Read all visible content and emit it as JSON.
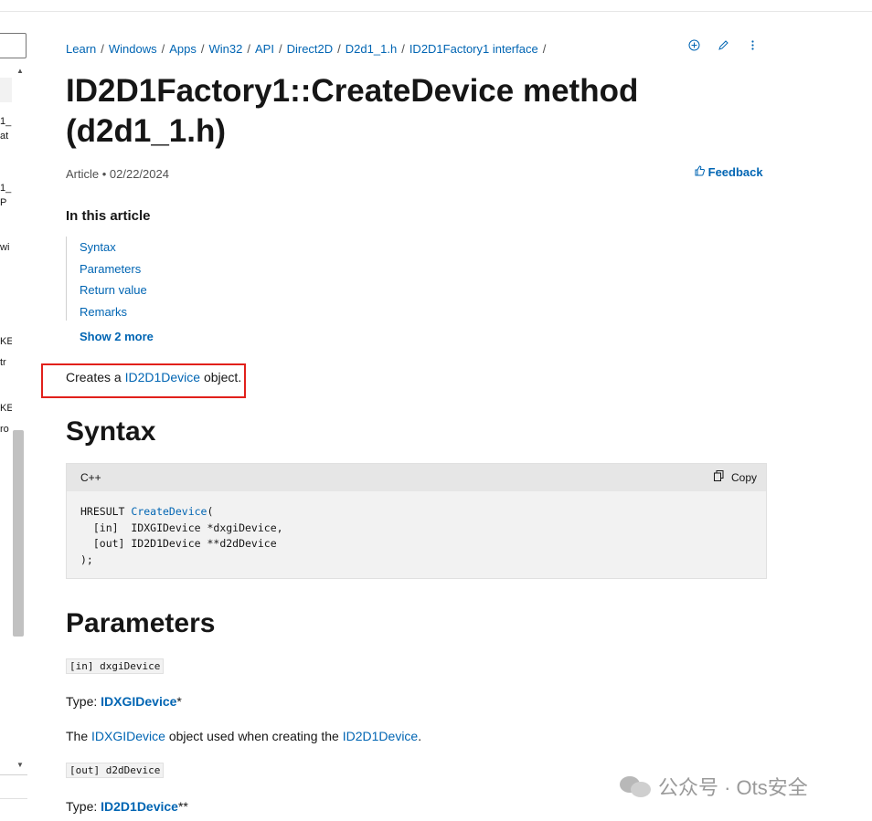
{
  "breadcrumb": [
    "Learn",
    "Windows",
    "Apps",
    "Win32",
    "API",
    "Direct2D",
    "D2d1_1.h",
    "ID2D1Factory1 interface"
  ],
  "separator": "/",
  "title": "ID2D1Factory1::CreateDevice method (d2d1_1.h)",
  "meta": "Article • 02/22/2024",
  "feedback": "Feedback",
  "in_this_article": {
    "heading": "In this article",
    "items": [
      "Syntax",
      "Parameters",
      "Return value",
      "Remarks"
    ],
    "show_more": "Show 2 more"
  },
  "description": {
    "pre": "Creates a ",
    "link": "ID2D1Device",
    "post": " object."
  },
  "syntax": {
    "heading": "Syntax",
    "lang": "C++",
    "copy": "Copy",
    "lines": [
      {
        "pre": "HRESULT ",
        "fn": "CreateDevice",
        "post": "("
      },
      {
        "pre": "  [in]  IDXGIDevice *dxgiDevice,",
        "fn": "",
        "post": ""
      },
      {
        "pre": "  [out] ID2D1Device **d2dDevice",
        "fn": "",
        "post": ""
      },
      {
        "pre": ");",
        "fn": "",
        "post": ""
      }
    ]
  },
  "parameters": {
    "heading": "Parameters",
    "p1_tag": "[in] dxgiDevice",
    "p1_type_label": "Type: ",
    "p1_type": "IDXGIDevice",
    "p1_type_suffix": "*",
    "p1_desc_pre": "The ",
    "p1_desc_link1": "IDXGIDevice",
    "p1_desc_mid": " object used when creating the ",
    "p1_desc_link2": "ID2D1Device",
    "p1_desc_post": ".",
    "p2_tag": "[out] d2dDevice",
    "p2_type_label": "Type: ",
    "p2_type": "ID2D1Device",
    "p2_type_suffix": "**"
  },
  "toc_fragments": [
    "1_",
    "at",
    "1_",
    "P",
    "wi",
    "KE",
    "tr",
    "KE",
    "ro"
  ],
  "watermark": "公众号 · Ots安全",
  "colors": {
    "link": "#0065b3",
    "highlight_box": "#e1201b",
    "code_bg": "#f2f2f2"
  }
}
